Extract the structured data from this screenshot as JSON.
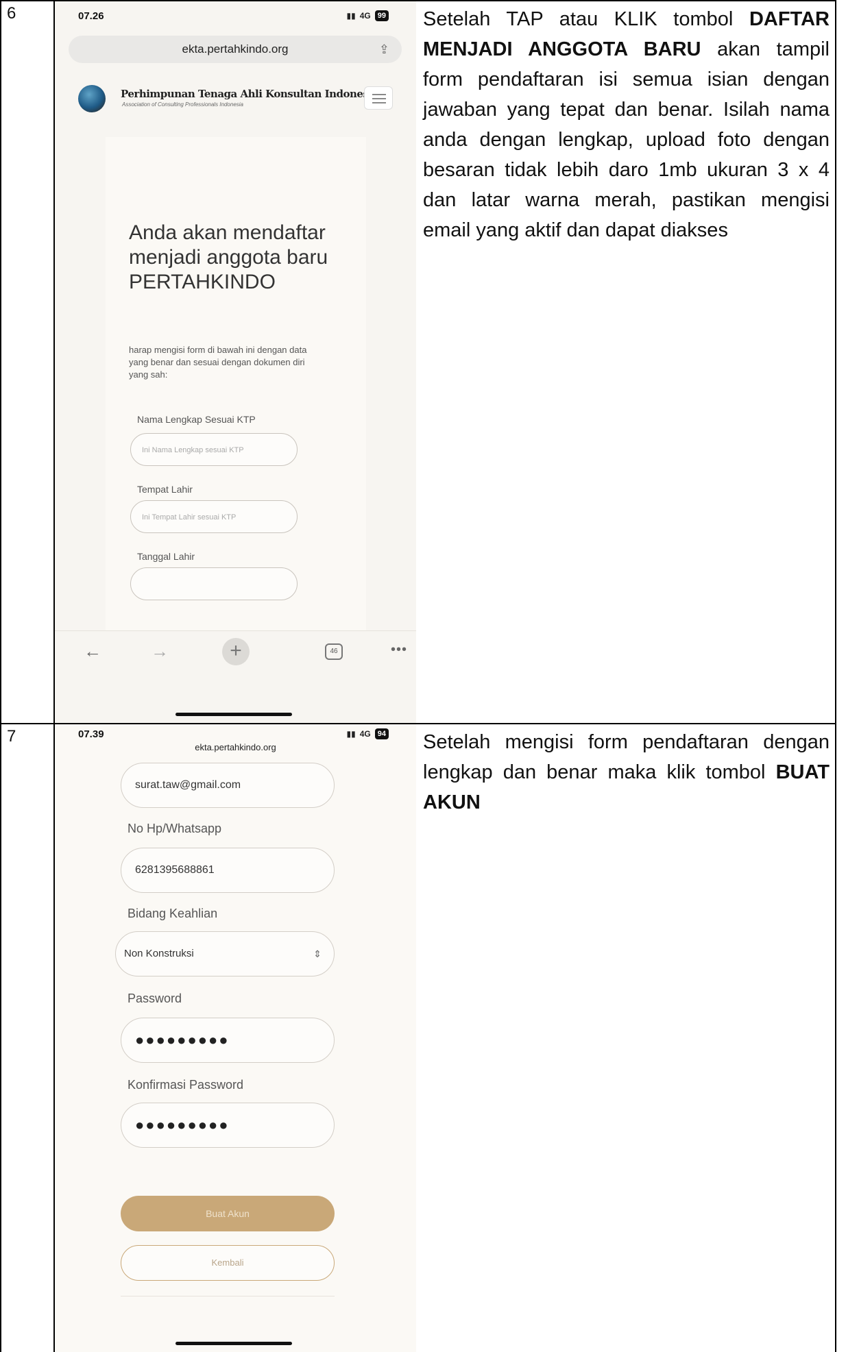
{
  "rows": [
    {
      "number": "6",
      "phone": {
        "time": "07.26",
        "signal": "4G",
        "battery": "99",
        "url": "ekta.pertahkindo.org",
        "brand_name": "Perhimpunan Tenaga Ahli Konsultan Indonesia",
        "brand_sub": "Association of Consulting Professionals Indonesia",
        "heading": "Anda akan mendaftar menjadi anggota baru PERTAHKINDO",
        "intro": "harap mengisi form di bawah ini dengan data yang benar dan sesuai dengan dokumen diri yang sah:",
        "fields": [
          {
            "label": "Nama Lengkap Sesuai KTP",
            "placeholder": "Ini Nama Lengkap sesuai KTP"
          },
          {
            "label": "Tempat Lahir",
            "placeholder": "Ini Tempat Lahir sesuai KTP"
          },
          {
            "label": "Tanggal Lahir",
            "placeholder": ""
          }
        ],
        "tab_count": "46",
        "more": "•••"
      },
      "description": {
        "p1": "Setelah TAP atau KLIK tombol ",
        "b1": "DAFTAR MENJADI ANGGOTA BARU",
        "p2": " akan tampil form pendaftaran isi semua isian dengan jawaban yang tepat dan benar.  Isilah nama anda dengan lengkap, upload foto dengan besaran tidak lebih daro 1mb ukuran 3 x 4 dan latar warna merah, pastikan mengisi email yang aktif dan dapat diakses"
      }
    },
    {
      "number": "7",
      "phone": {
        "time": "07.39",
        "signal": "4G",
        "battery": "94",
        "url": "ekta.pertahkindo.org",
        "email_value": "surat.taw@gmail.com",
        "phone_label": "No Hp/Whatsapp",
        "phone_value": "6281395688861",
        "bidang_label": "Bidang Keahlian",
        "bidang_value": "Non Konstruksi",
        "password_label": "Password",
        "password_value": "●●●●●●●●●",
        "confirm_label": "Konfirmasi Password",
        "confirm_value": "●●●●●●●●●",
        "buat_label": "Buat Akun",
        "kembali_label": "Kembali"
      },
      "description": {
        "p1": "Setelah mengisi form pendaftaran dengan lengkap dan benar maka klik tombol ",
        "b1": "BUAT AKUN"
      }
    }
  ]
}
